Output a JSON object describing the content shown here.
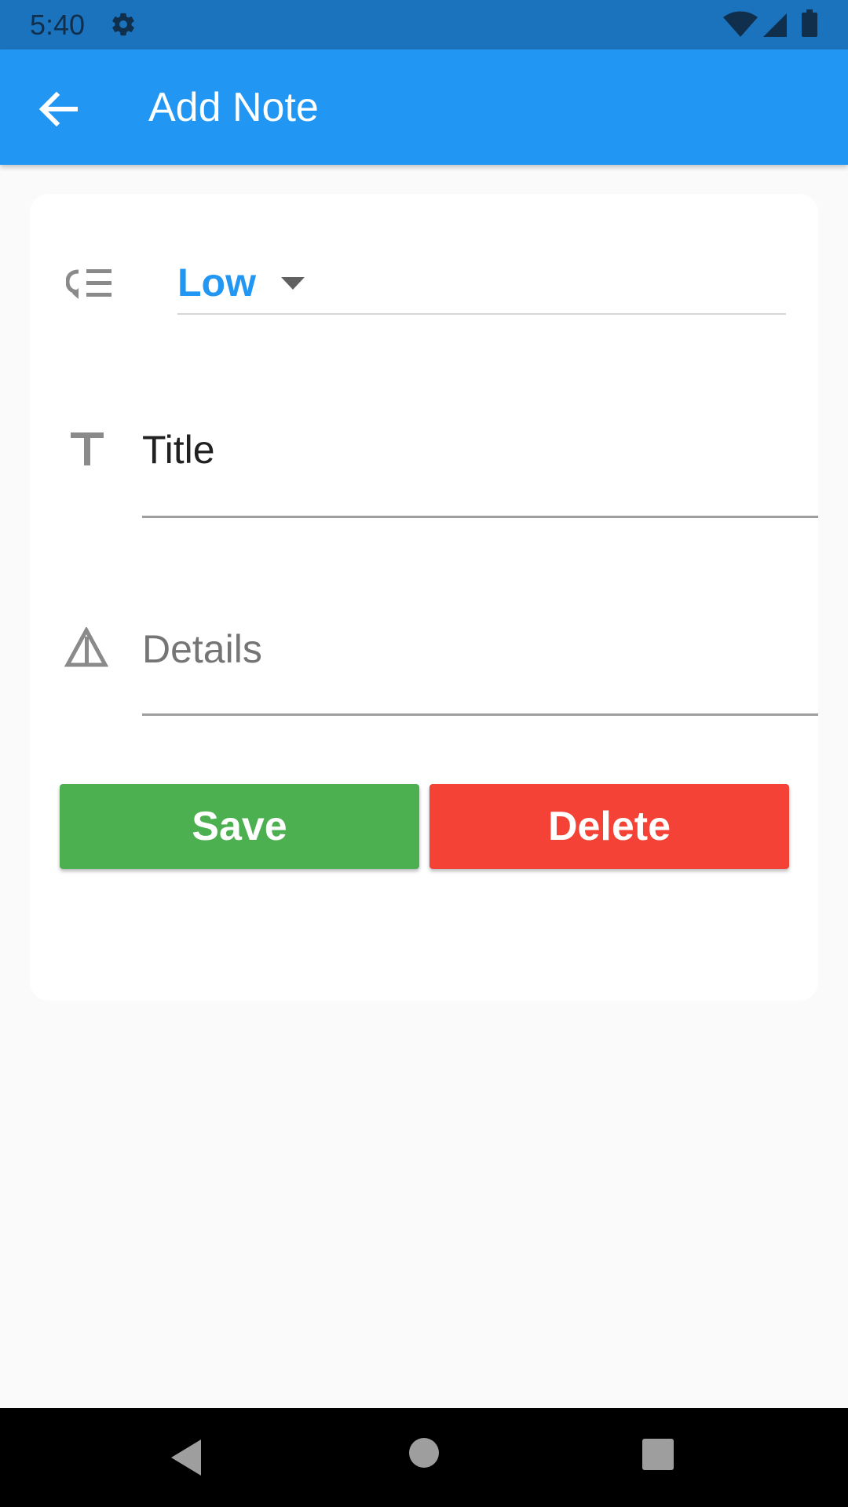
{
  "status_bar": {
    "time": "5:40",
    "icons": [
      "gear-icon",
      "wifi-icon",
      "cell-signal-icon",
      "battery-icon"
    ]
  },
  "app_bar": {
    "title": "Add Note",
    "back_icon": "arrow-back-icon",
    "background": "#2196f3"
  },
  "form": {
    "priority": {
      "icon": "priority-list-icon",
      "selected": "Low",
      "color": "#2196f3"
    },
    "title": {
      "icon": "text-title-icon",
      "value": "Title"
    },
    "details": {
      "icon": "warning-triangle-icon",
      "placeholder": "Details"
    },
    "buttons": {
      "save": {
        "label": "Save",
        "color": "#4caf50"
      },
      "delete": {
        "label": "Delete",
        "color": "#f44336"
      }
    }
  },
  "nav_bar": {
    "icons": [
      "nav-back-icon",
      "nav-home-icon",
      "nav-recents-icon"
    ]
  }
}
